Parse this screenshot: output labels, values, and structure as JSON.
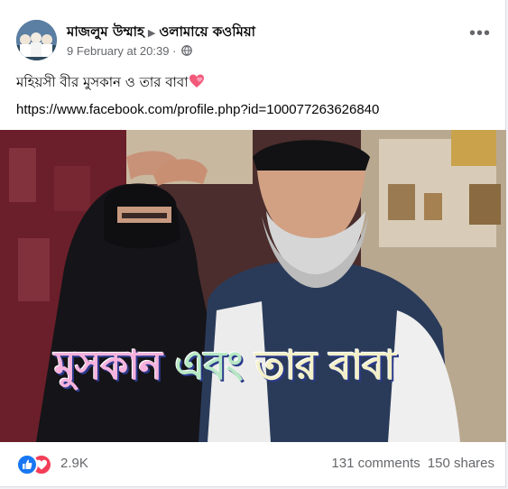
{
  "post": {
    "author": "মাজলুম উম্মাহ",
    "group": "ওলামায়ে কওমিয়া",
    "date": "9 February at 20:39",
    "separator": "·",
    "more_icon": "more-horizontal-icon",
    "caption": "মহিয়সী বীর মুসকান ও তার বাবা",
    "link": "https://www.facebook.com/profile.php?id=100077263626840",
    "image_overlay_text": {
      "part1": "মুসকান ",
      "part2": "এবং ",
      "part3": "তার বাবা"
    }
  },
  "footer": {
    "reaction_count": "2.9K",
    "comments": "131 comments",
    "shares": "150 shares"
  },
  "colors": {
    "like_blue": "#1877f2",
    "love_red": "#f33e58",
    "secondary_text": "#65676b"
  }
}
